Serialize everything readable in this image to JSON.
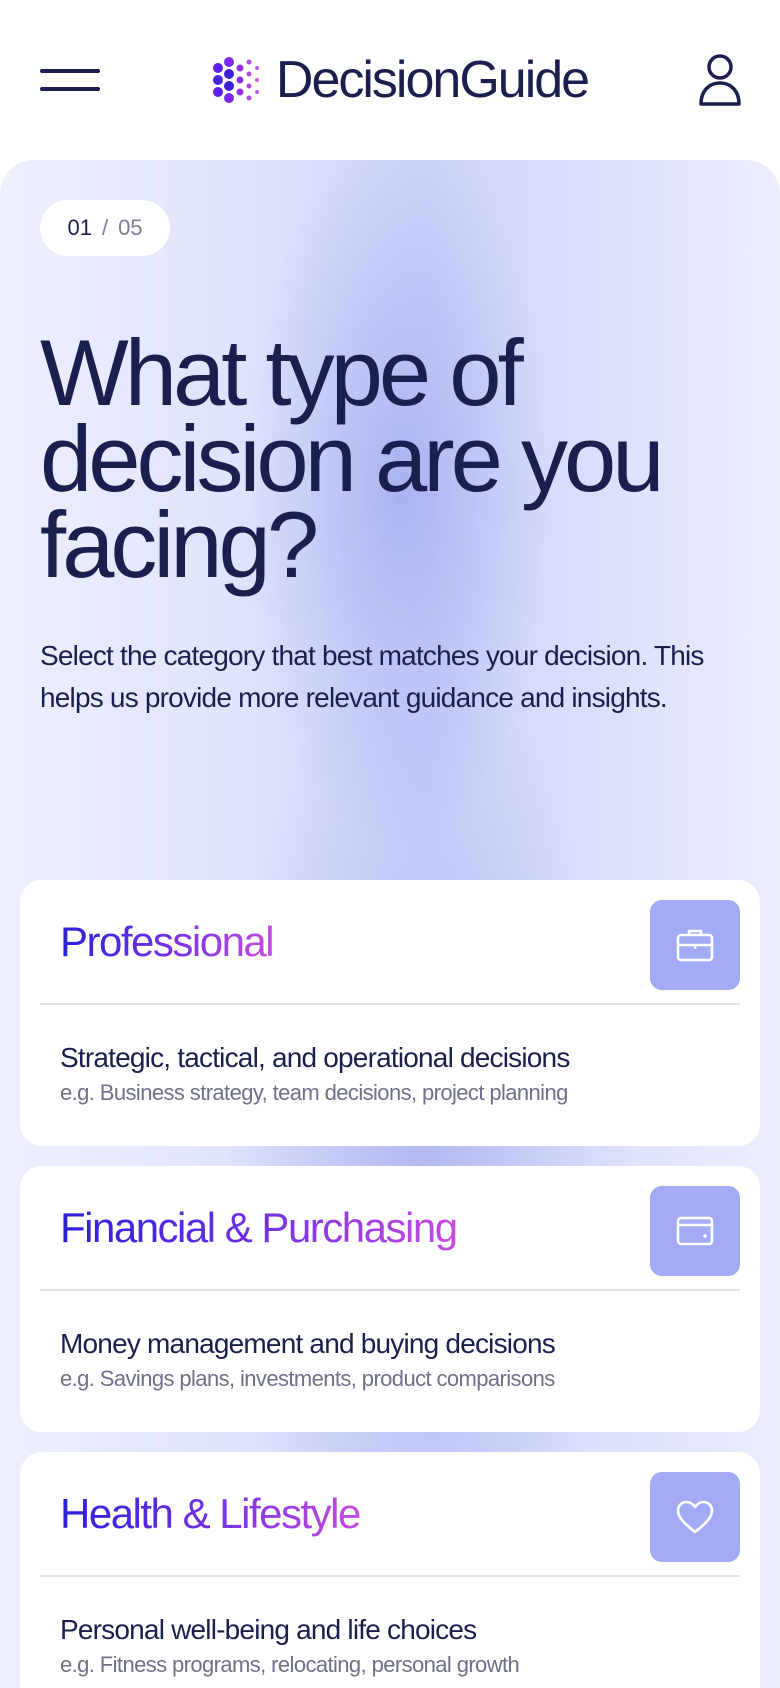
{
  "header": {
    "logo_text": "DecisionGuide",
    "menu_icon": "hamburger-menu-icon",
    "user_icon": "user-profile-icon",
    "logo_icon": "dotted-logo-mark",
    "brand_colors": {
      "navy": "#1b1f4d",
      "purple": "#6a2ee6",
      "violet": "#3b1fe0"
    }
  },
  "progress": {
    "current": "01",
    "separator": "/",
    "total": "05"
  },
  "main": {
    "title": "What type of decision are you facing?",
    "subtitle": "Select the category that best matches your decision. This helps us provide more relevant guidance and insights."
  },
  "categories": [
    {
      "title": "Professional",
      "description": "Strategic, tactical, and operational decisions",
      "example": "e.g. Business strategy, team decisions, project planning",
      "icon": "briefcase-icon"
    },
    {
      "title": "Financial & Purchasing",
      "description": "Money management and buying decisions",
      "example": "e.g. Savings plans, investments, product comparisons",
      "icon": "wallet-icon"
    },
    {
      "title": "Health & Lifestyle",
      "description": "Personal well-being and life choices",
      "example": "e.g. Fitness programs, relocating, personal growth",
      "icon": "heart-icon"
    }
  ],
  "colors": {
    "card_icon_bg": "#a3aaf6",
    "title_gradient_start": "#2b1fd9",
    "title_gradient_end": "#c64be0"
  }
}
